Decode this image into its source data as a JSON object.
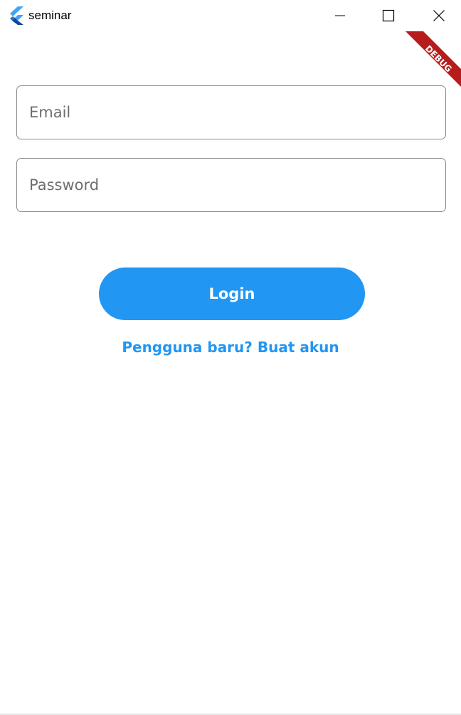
{
  "window": {
    "title": "seminar",
    "controls": [
      "minimize-icon",
      "maximize-icon",
      "close-icon"
    ]
  },
  "debug_banner": {
    "label": "DEBUG",
    "color": "#b71c1c"
  },
  "form": {
    "email_placeholder": "Email",
    "password_placeholder": "Password",
    "login_label": "Login",
    "register_link": "Pengguna baru? Buat akun"
  },
  "colors": {
    "accent": "#2196f3",
    "field_border": "#8a8a8a",
    "background": "#ffffff"
  }
}
